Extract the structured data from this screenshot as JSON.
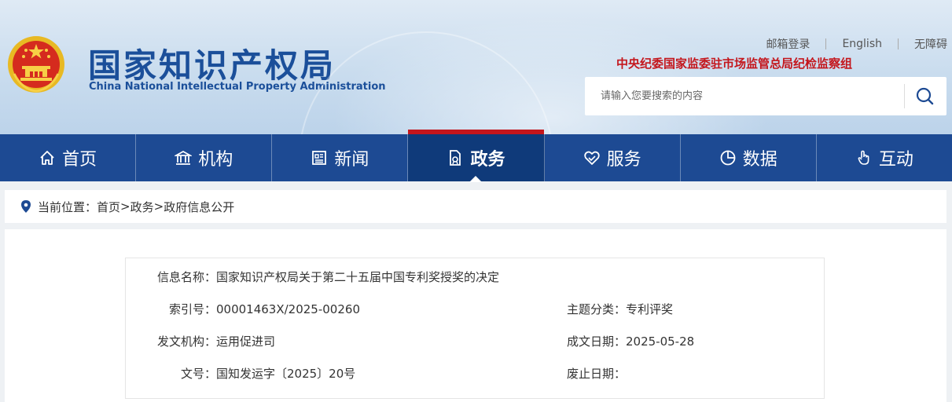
{
  "header": {
    "logo_cn": "国家知识产权局",
    "logo_en": "China National Intellectual Property Administration",
    "links": {
      "email": "邮箱登录",
      "english": "English",
      "accessibility": "无障碍"
    },
    "discipline": "中央纪委国家监委驻市场监管总局纪检监察组",
    "search_placeholder": "请输入您要搜索的内容",
    "colors": {
      "brand_blue": "#1b4f9a",
      "red": "#c4161c"
    }
  },
  "nav": {
    "items": [
      {
        "label": "首页",
        "icon": "home-icon"
      },
      {
        "label": "机构",
        "icon": "institution-icon"
      },
      {
        "label": "新闻",
        "icon": "news-icon"
      },
      {
        "label": "政务",
        "icon": "government-affairs-icon",
        "active": true
      },
      {
        "label": "服务",
        "icon": "service-icon"
      },
      {
        "label": "数据",
        "icon": "data-icon"
      },
      {
        "label": "互动",
        "icon": "interaction-icon"
      }
    ],
    "colors": {
      "bg": "#1d4a93",
      "active_bg": "#0f3a7a"
    }
  },
  "breadcrumb": {
    "prefix": "当前位置：",
    "home": "首页",
    "sep1": ">",
    "section": "政务",
    "sep2": ">",
    "current": "政府信息公开"
  },
  "info": {
    "name_label": "信息名称：",
    "name_value": "国家知识产权局关于第二十五届中国专利奖授奖的决定",
    "index_label": "索引号：",
    "index_value": "00001463X/2025-00260",
    "topic_label": "主题分类：",
    "topic_value": "专利评奖",
    "issuer_label": "发文机构：",
    "issuer_value": "运用促进司",
    "date_label": "成文日期：",
    "date_value": "2025-05-28",
    "docno_label": "文号：",
    "docno_value": "国知发运字〔2025〕20号",
    "abolish_label": "废止日期：",
    "abolish_value": ""
  }
}
